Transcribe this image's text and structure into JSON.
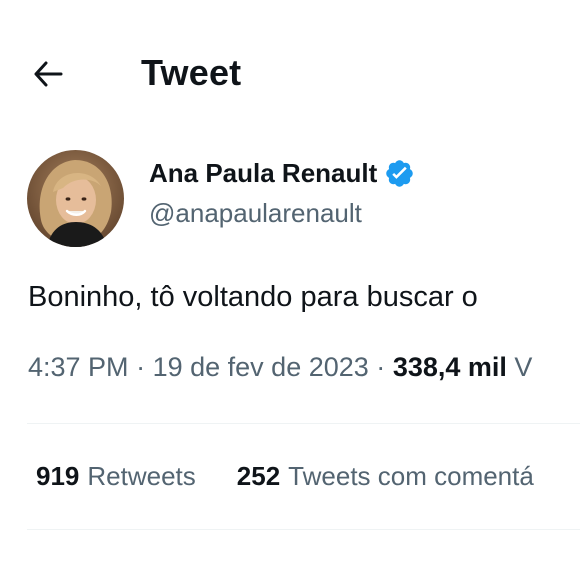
{
  "header": {
    "title": "Tweet",
    "back_icon": "arrow-left-icon"
  },
  "author": {
    "display_name": "Ana Paula Renault",
    "handle": "@anapaularenault",
    "verified_icon": "verified-badge-icon",
    "verified_color": "#1d9bf0"
  },
  "tweet": {
    "text": "Boninho, tô voltando para buscar o",
    "time": "4:37 PM",
    "separator": "·",
    "date": "19 de fev de 2023",
    "views_count": "338,4 mil",
    "views_label": "V"
  },
  "stats": {
    "retweets_count": "919",
    "retweets_label": "Retweets",
    "quotes_count": "252",
    "quotes_label": "Tweets com comentá"
  },
  "colors": {
    "text_primary": "#0f1419",
    "text_secondary": "#536471",
    "divider": "#eff3f4",
    "accent": "#1d9bf0"
  }
}
